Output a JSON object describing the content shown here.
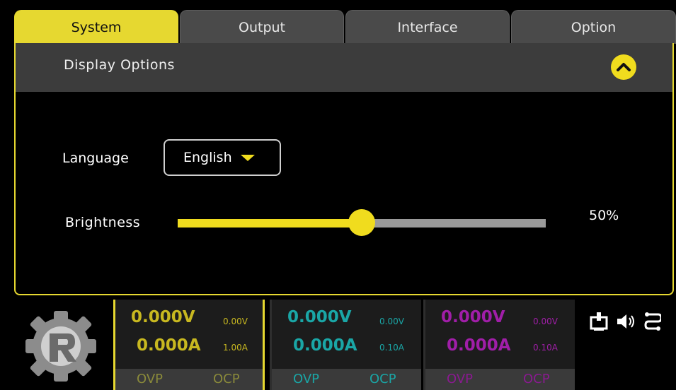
{
  "tabs": [
    {
      "label": "System",
      "active": true
    },
    {
      "label": "Output",
      "active": false
    },
    {
      "label": "Interface",
      "active": false
    },
    {
      "label": "Option",
      "active": false
    }
  ],
  "section": {
    "title": "Display Options"
  },
  "language": {
    "label": "Language",
    "value": "English"
  },
  "brightness": {
    "label": "Brightness",
    "value_text": "50%",
    "level_percent": 50
  },
  "channels": [
    {
      "voltage": "0.000V",
      "current": "0.000A",
      "set_voltage": "0.00V",
      "set_current": "1.00A",
      "ovp": "OVP",
      "ocp": "OCP",
      "color": "#c8b820",
      "label_color": "#8a8a3a"
    },
    {
      "voltage": "0.000V",
      "current": "0.000A",
      "set_voltage": "0.00V",
      "set_current": "0.10A",
      "ovp": "OVP",
      "ocp": "OCP",
      "color": "#1aa6a6",
      "label_color": "#1aa6a6"
    },
    {
      "voltage": "0.000V",
      "current": "0.000A",
      "set_voltage": "0.00V",
      "set_current": "0.10A",
      "ovp": "OVP",
      "ocp": "OCP",
      "color": "#a01ea8",
      "label_color": "#8a1a90"
    }
  ],
  "icons": [
    "remote-device-icon",
    "speaker-icon",
    "connection-icon",
    "gear-logo-icon",
    "chevron-up-icon",
    "caret-down-icon"
  ],
  "colors": {
    "accent": "#e6d830",
    "panel_header": "#3c3c3c",
    "tab_inactive": "#4a4a4a"
  }
}
